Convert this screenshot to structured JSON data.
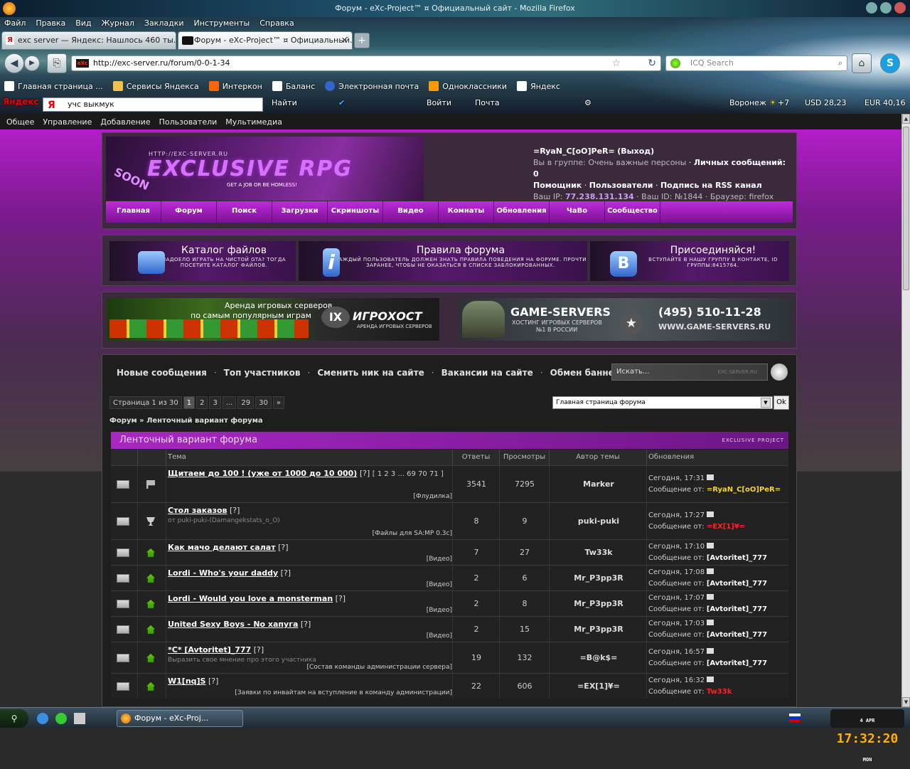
{
  "window": {
    "title": "Форум - eXc-Project™ ¤ Официальный сайт - Mozilla Firefox"
  },
  "menu": [
    "Файл",
    "Правка",
    "Вид",
    "Журнал",
    "Закладки",
    "Инструменты",
    "Справка"
  ],
  "tabs": [
    {
      "label": "exc server — Яндекс: Нашлось 460 ты..."
    },
    {
      "label": "Форум - eXc-Project™ ¤ Официальный..."
    }
  ],
  "nav": {
    "url": "http://exc-server.ru/forum/0-0-1-34",
    "search_placeholder": "ICQ Search",
    "url_favicon": "eXc"
  },
  "bookmarks": [
    "Главная страница ...",
    "Сервисы Яндекса",
    "Интеркон",
    "Баланс",
    "Электронная почта",
    "Одноклассники",
    "Яндекс"
  ],
  "yandexbar": {
    "logo": "Яндекс",
    "query": "учс выкмук",
    "search_btn": "Найти",
    "login": "Войти",
    "mail": "Почта",
    "city": "Воронеж",
    "temp": "+7",
    "usd": "USD 28,23",
    "eur": "EUR 40,16"
  },
  "sitemenu": [
    "Общее",
    "Управление",
    "Добавление",
    "Пользователи",
    "Мультимедиа"
  ],
  "header": {
    "logo_url": "HTTP://EXC-SERVER.RU",
    "logo_text": "EXCLUSIVE RPG",
    "logo_tag": "GET A JOB OR BE HOMLESS!",
    "logo_soon": "SOON",
    "user": "=RyaN_C[oO]PeR=",
    "logout": "(Выход)",
    "group_label": "Вы в группе:",
    "group": "Очень важные персоны",
    "personal": "Личных сообщений: 0",
    "helper": "Помощник",
    "users": "Пользователи",
    "rss": "Подпись на RSS канал",
    "ip_label": "Ваш IP:",
    "ip": "77.238.131.134",
    "id": "Ваш ID: №1844",
    "browser": "Браузер: firefox"
  },
  "navstrip": [
    "Главная",
    "Форум",
    "Поиск",
    "Загрузки",
    "Скриншоты",
    "Видео",
    "Комнаты",
    "Обновления",
    "ЧаВо",
    "Сообщество"
  ],
  "info": [
    {
      "title": "Каталог файлов",
      "desc": "НАДОЕЛО ИГРАТЬ НА ЧИСТОЙ GTA? ТОГДА ПОСЕТИТЕ КАТАЛОГ ФАЙЛОВ."
    },
    {
      "title": "Правила форума",
      "desc": "КАЖДЫЙ ПОЛЬЗОВАТЕЛЬ ДОЛЖЕН ЗНАТЬ ПРАВИЛА ПОВЕДЕНИЯ НА ФОРУМЕ. ПРОЧТИ ЗАРАНЕЕ, ЧТОБЫ НЕ ОКАЗАТЬСЯ В СПИСКЕ ЗАБЛОКИРОВАННЫХ."
    },
    {
      "title": "Присоединяйся!",
      "desc": "ВСТУПАЙТЕ В НАШУ ГРУППУ В КОНТАКТЕ, ID ГРУППЫ:8415764."
    }
  ],
  "banners": {
    "b1_line1": "Аренда игровых серверов",
    "b1_line2": "по самым популярным играм",
    "b1_brand": "ИГРОХОСТ",
    "b1_sub": "АРЕНДА ИГРОВЫХ СЕРВЕРОВ",
    "b2_brand": "GAME-SERVERS",
    "b2_sub1": "ХОСТИНГ ИГРОВЫХ СЕРВЕРОВ",
    "b2_sub2": "№1 В РОССИИ",
    "b2_phone": "(495) 510-11-28",
    "b2_site": "WWW.GAME-SERVERS.RU"
  },
  "forumlinks": [
    "Новые сообщения",
    "Топ участников",
    "Сменить ник на сайте",
    "Вакансии на сайте",
    "Обмен баннерами"
  ],
  "search": {
    "placeholder": "Искать...",
    "hint": "EXC-SERVER.RU"
  },
  "pager": {
    "label": "Страница 1 из 30",
    "pages": [
      "1",
      "2",
      "3",
      "...",
      "29",
      "30",
      "»"
    ],
    "current": "1"
  },
  "jump": {
    "value": "Главная страница форума",
    "ok": "Ok"
  },
  "crumb": {
    "forum": "Форум",
    "sep": "»",
    "current": "Ленточный вариант форума"
  },
  "ftitle": {
    "title": "Ленточный вариант форума",
    "right": "EXCLUSIVE PROJECT"
  },
  "columns": {
    "topic": "Тема",
    "replies": "Ответы",
    "views": "Просмотры",
    "author": "Автор темы",
    "updates": "Обновления"
  },
  "rows": [
    {
      "title": "Щитаем до 100 ! (уже от 1000 до 10 000)",
      "q": "[?]",
      "pages": "[ 1 2 3 ... 69 70 71 ]",
      "sub": "",
      "forum": "[Флудилка]",
      "replies": "3541",
      "views": "7295",
      "author": "Marker",
      "time": "Сегодня, 17:31",
      "by_label": "Сообщение от:",
      "by": "=RyaN_C[oO]PeR=",
      "by_color": "y",
      "icon": "flag"
    },
    {
      "title": "Стол заказов",
      "q": "[?]",
      "pages": "",
      "sub": "от puki-puki-(Damangekstats_o_O)",
      "forum": "[Файлы для SA:MP 0.3c]",
      "replies": "8",
      "views": "9",
      "author": "puki-puki",
      "time": "Сегодня, 17:27",
      "by_label": "Сообщение от:",
      "by": "=EX[1]¥=",
      "by_color": "r",
      "icon": "cup"
    },
    {
      "title": "Как мачо делают салат",
      "q": "[?]",
      "pages": "",
      "sub": "",
      "forum": "[Видео]",
      "replies": "7",
      "views": "27",
      "author": "Tw33k",
      "time": "Сегодня, 17:10",
      "by_label": "Сообщение от:",
      "by": "[Avtoritet]_777",
      "by_color": "w",
      "icon": "home"
    },
    {
      "title": "Lordi - Who's your daddy",
      "q": "[?]",
      "pages": "",
      "sub": "",
      "forum": "[Видео]",
      "replies": "2",
      "views": "6",
      "author": "Mr_P3pp3R",
      "time": "Сегодня, 17:08",
      "by_label": "Сообщение от:",
      "by": "[Avtoritet]_777",
      "by_color": "w",
      "icon": "home"
    },
    {
      "title": "Lordi - Would you love a monsterman",
      "q": "[?]",
      "pages": "",
      "sub": "",
      "forum": "[Видео]",
      "replies": "2",
      "views": "8",
      "author": "Mr_P3pp3R",
      "time": "Сегодня, 17:07",
      "by_label": "Сообщение от:",
      "by": "[Avtoritet]_777",
      "by_color": "w",
      "icon": "home"
    },
    {
      "title": "United Sexy Boys - No хапуга",
      "q": "[?]",
      "pages": "",
      "sub": "",
      "forum": "[Видео]",
      "replies": "2",
      "views": "15",
      "author": "Mr_P3pp3R",
      "time": "Сегодня, 17:03",
      "by_label": "Сообщение от:",
      "by": "[Avtoritet]_777",
      "by_color": "w",
      "icon": "home"
    },
    {
      "title": "*C* [Avtoritet]_777",
      "q": "[?]",
      "pages": "",
      "sub": "Выразить свое мнение про этого участника",
      "forum": "[Состав команды администрации сервера]",
      "replies": "19",
      "views": "132",
      "author": "=B@k$=",
      "time": "Сегодня, 16:57",
      "by_label": "Сообщение от:",
      "by": "[Avtoritet]_777",
      "by_color": "w",
      "icon": "home"
    },
    {
      "title": "W1[nq]S",
      "q": "[?]",
      "pages": "",
      "sub": "",
      "forum": "[Заявки по инвайтам на вступление в команду администрации]",
      "replies": "22",
      "views": "606",
      "author": "=EX[1]¥=",
      "time": "Сегодня, 16:32",
      "by_label": "Сообщение от:",
      "by": "Tw33k",
      "by_color": "r",
      "icon": "home"
    }
  ],
  "taskbar": {
    "item": "Форум - eXc-Proj...",
    "clock": "17:32:20",
    "clock_day": "MON",
    "clock_date": "4 APR"
  },
  "colors": {
    "accent": "#a827c4",
    "bg_dark": "#1e1e1e",
    "yellow": "#f6d42a",
    "red": "#f22"
  }
}
